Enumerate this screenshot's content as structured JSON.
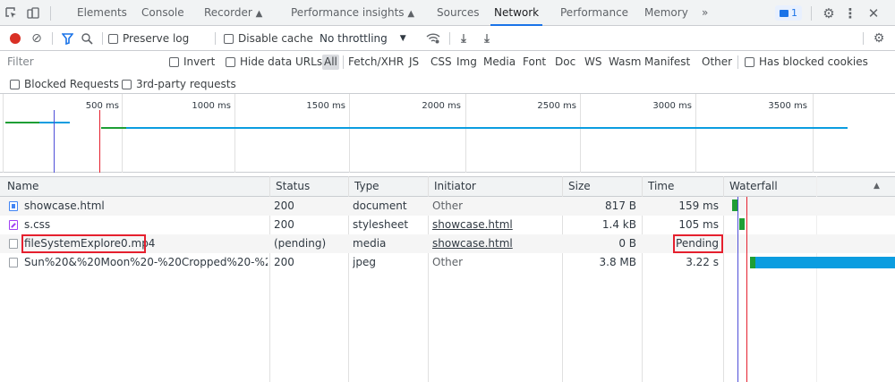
{
  "tabbar": {
    "tabs": [
      {
        "label": "Elements"
      },
      {
        "label": "Console"
      },
      {
        "label": "Recorder"
      },
      {
        "label": "Performance insights"
      },
      {
        "label": "Sources"
      },
      {
        "label": "Network"
      },
      {
        "label": "Performance"
      },
      {
        "label": "Memory"
      }
    ],
    "more": "»",
    "issues_count": "1",
    "active": "Network"
  },
  "toolbar": {
    "preserve_log": "Preserve log",
    "disable_cache": "Disable cache",
    "throttling": "No throttling"
  },
  "filter": {
    "placeholder": "Filter",
    "invert": "Invert",
    "hide_data_urls": "Hide data URLs",
    "types": [
      "All",
      "Fetch/XHR",
      "JS",
      "CSS",
      "Img",
      "Media",
      "Font",
      "Doc",
      "WS",
      "Wasm",
      "Manifest",
      "Other"
    ],
    "selected_type": "All",
    "has_blocked_cookies": "Has blocked cookies",
    "blocked_requests": "Blocked Requests",
    "third_party": "3rd-party requests"
  },
  "overview": {
    "ticks": [
      "500 ms",
      "1000 ms",
      "1500 ms",
      "2000 ms",
      "2500 ms",
      "3000 ms",
      "3500 ms"
    ]
  },
  "table": {
    "columns": [
      "Name",
      "Status",
      "Type",
      "Initiator",
      "Size",
      "Time",
      "Waterfall"
    ],
    "rows": [
      {
        "name": "showcase.html",
        "status": "200",
        "type": "document",
        "initiator": "Other",
        "size": "817 B",
        "time": "159 ms"
      },
      {
        "name": "s.css",
        "status": "200",
        "type": "stylesheet",
        "initiator": "showcase.html",
        "size": "1.4 kB",
        "time": "105 ms"
      },
      {
        "name": "fileSystemExplore0.mp4",
        "status": "(pending)",
        "type": "media",
        "initiator": "showcase.html",
        "size": "0 B",
        "time": "Pending"
      },
      {
        "name": "Sun%20&%20Moon%20-%20Cropped%20-%2...",
        "status": "200",
        "type": "jpeg",
        "initiator": "Other",
        "size": "3.8 MB",
        "time": "3.22 s"
      }
    ]
  },
  "colors": {
    "accent": "#1a73e8",
    "record": "#d93025",
    "highlight": "#e5202e",
    "waterfall_blue": "#0b9de0",
    "waterfall_green": "#1e9e35"
  }
}
